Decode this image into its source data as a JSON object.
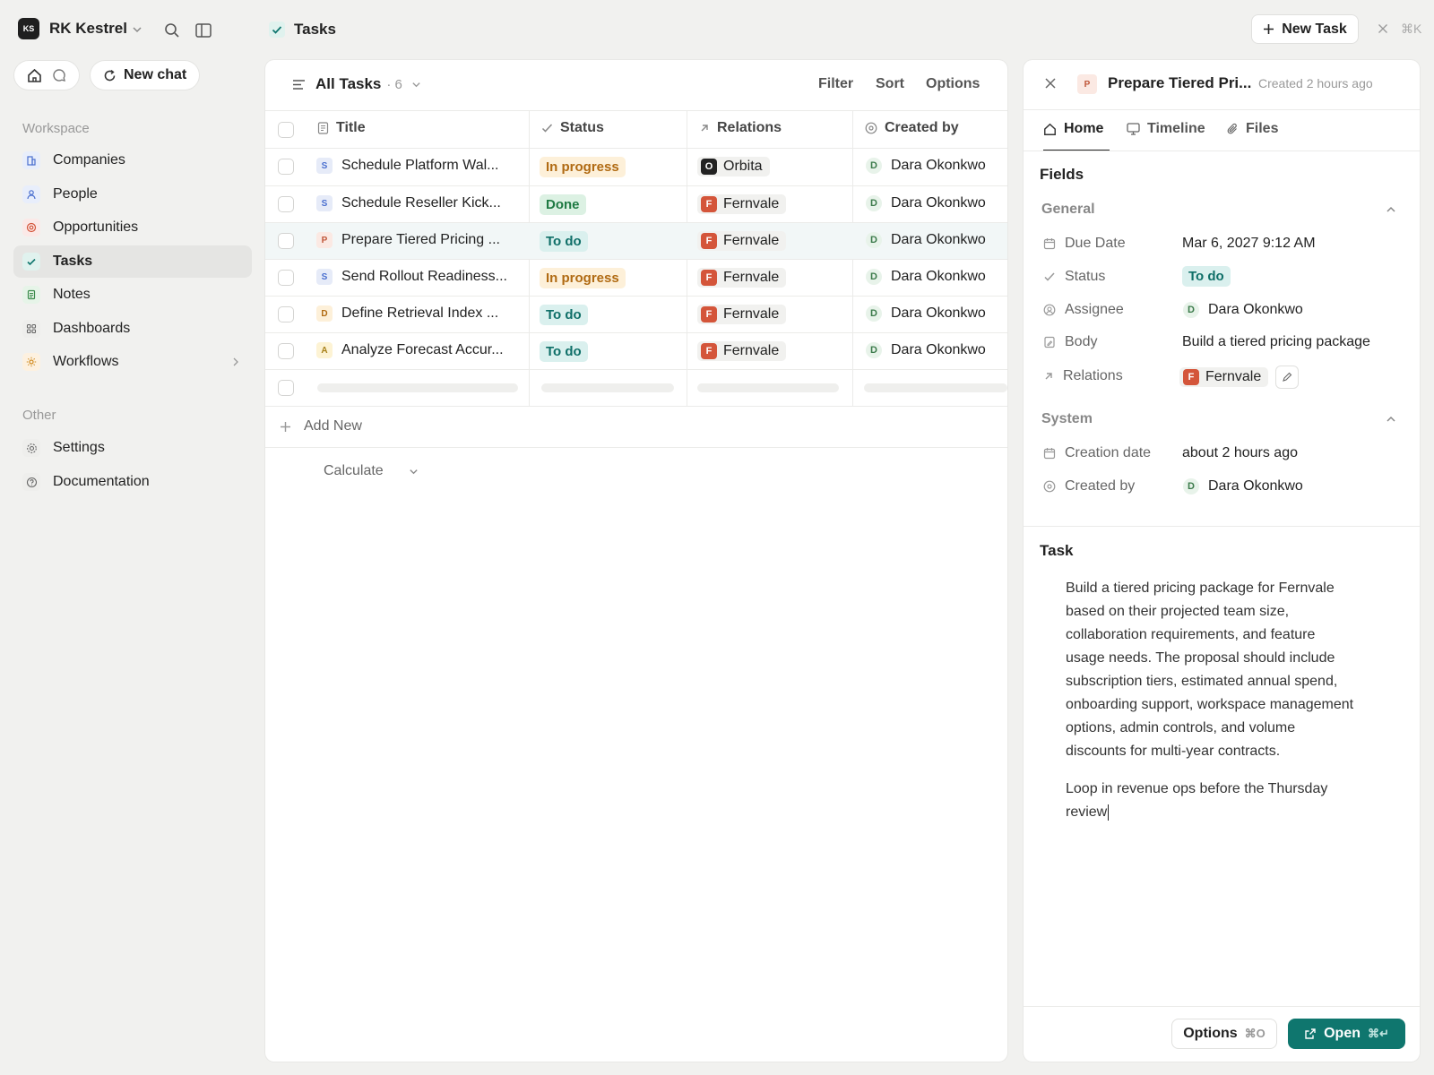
{
  "workspace": {
    "logo": "KS",
    "name": "RK Kestrel"
  },
  "topbar": {
    "new_chat": "New chat",
    "page_title": "Tasks",
    "new_task": "New Task",
    "shortcut": "⌘K"
  },
  "sidebar": {
    "workspace_label": "Workspace",
    "items": [
      {
        "label": "Companies",
        "icon": "building-icon"
      },
      {
        "label": "People",
        "icon": "person-icon"
      },
      {
        "label": "Opportunities",
        "icon": "target-icon"
      },
      {
        "label": "Tasks",
        "icon": "check-icon"
      },
      {
        "label": "Notes",
        "icon": "note-icon"
      },
      {
        "label": "Dashboards",
        "icon": "grid-icon"
      },
      {
        "label": "Workflows",
        "icon": "sun-icon"
      }
    ],
    "other_label": "Other",
    "other_items": [
      {
        "label": "Settings",
        "icon": "gear-icon"
      },
      {
        "label": "Documentation",
        "icon": "help-icon"
      }
    ]
  },
  "table": {
    "view_name": "All Tasks",
    "count": "· 6",
    "actions": {
      "filter": "Filter",
      "sort": "Sort",
      "options": "Options"
    },
    "columns": [
      "Title",
      "Status",
      "Relations",
      "Created by"
    ],
    "rows": [
      {
        "letter": "S",
        "title": "Schedule Platform Wal...",
        "status": "In progress",
        "relation": "Orbita",
        "relation_letter": "O",
        "created_by": "Dara Okonkwo",
        "avatar": "D"
      },
      {
        "letter": "S",
        "title": "Schedule Reseller Kick...",
        "status": "Done",
        "relation": "Fernvale",
        "relation_letter": "F",
        "created_by": "Dara Okonkwo",
        "avatar": "D"
      },
      {
        "letter": "P",
        "title": "Prepare Tiered Pricing ...",
        "status": "To do",
        "relation": "Fernvale",
        "relation_letter": "F",
        "created_by": "Dara Okonkwo",
        "avatar": "D"
      },
      {
        "letter": "S",
        "title": "Send Rollout Readiness...",
        "status": "In progress",
        "relation": "Fernvale",
        "relation_letter": "F",
        "created_by": "Dara Okonkwo",
        "avatar": "D"
      },
      {
        "letter": "D",
        "title": "Define Retrieval Index ...",
        "status": "To do",
        "relation": "Fernvale",
        "relation_letter": "F",
        "created_by": "Dara Okonkwo",
        "avatar": "D"
      },
      {
        "letter": "A",
        "title": "Analyze Forecast Accur...",
        "status": "To do",
        "relation": "Fernvale",
        "relation_letter": "F",
        "created_by": "Dara Okonkwo",
        "avatar": "D"
      }
    ],
    "add_new": "Add New",
    "calculate": "Calculate"
  },
  "panel": {
    "record_letter": "P",
    "title": "Prepare Tiered Pri...",
    "created": "Created 2 hours ago",
    "tabs": [
      "Home",
      "Timeline",
      "Files"
    ],
    "fields_heading": "Fields",
    "general_label": "General",
    "fields": {
      "due_date_label": "Due Date",
      "due_date": "Mar 6, 2027 9:12 AM",
      "status_label": "Status",
      "status": "To do",
      "assignee_label": "Assignee",
      "assignee": "Dara Okonkwo",
      "assignee_avatar": "D",
      "body_label": "Body",
      "body": "Build a tiered pricing package",
      "relations_label": "Relations",
      "relation": "Fernvale",
      "relation_letter": "F"
    },
    "system_label": "System",
    "system": {
      "creation_date_label": "Creation date",
      "creation_date": "about 2 hours ago",
      "created_by_label": "Created by",
      "created_by": "Dara Okonkwo",
      "created_by_avatar": "D"
    },
    "task_heading": "Task",
    "task_body_lines": [
      "Build a tiered pricing package for Fernvale",
      "based on their projected team size,",
      "collaboration requirements, and feature",
      "usage needs. The proposal should include",
      "subscription tiers, estimated annual spend,",
      "onboarding support, workspace management",
      "options, admin controls, and volume",
      "discounts for multi-year contracts."
    ],
    "task_note_lines": [
      "Loop in revenue ops before the Thursday",
      "review"
    ],
    "footer": {
      "options": "Options",
      "options_kbd": "⌘O",
      "open": "Open",
      "open_kbd": "⌘↵"
    }
  },
  "colors": {
    "accent": "#0f766e",
    "status_progress": "#b06a12",
    "status_done": "#1f7a43",
    "status_todo": "#0f6f68",
    "fernvale": "#d4553a",
    "orbita": "#222222"
  }
}
